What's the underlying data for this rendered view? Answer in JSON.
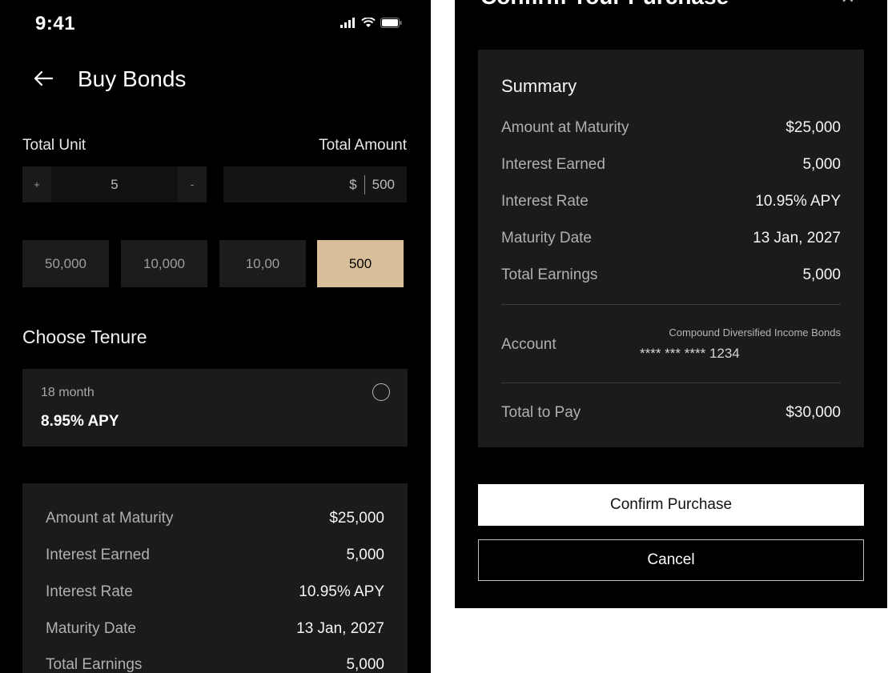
{
  "status_bar": {
    "time": "9:41",
    "icons": [
      "signal-icon",
      "wifi-icon",
      "battery-icon"
    ]
  },
  "header": {
    "title": "Buy Bonds",
    "back_icon": "arrow-left-icon"
  },
  "units": {
    "label": "Total Unit",
    "value": "5",
    "plus": "+",
    "minus": "-"
  },
  "amount": {
    "label": "Total Amount",
    "currency": "$",
    "value": "500"
  },
  "quick_amounts": [
    {
      "label": "50,000",
      "selected": false
    },
    {
      "label": "10,000",
      "selected": false
    },
    {
      "label": "10,00",
      "selected": false
    },
    {
      "label": "500",
      "selected": true
    }
  ],
  "tenure": {
    "title": "Choose Tenure",
    "option_label": "18 month",
    "option_apy": "8.95% APY"
  },
  "details": [
    {
      "key": "Amount at Maturity",
      "value": "$25,000"
    },
    {
      "key": "Interest Earned",
      "value": "5,000"
    },
    {
      "key": "Interest Rate",
      "value": "10.95% APY"
    },
    {
      "key": "Maturity Date",
      "value": "13 Jan, 2027"
    },
    {
      "key": "Total Earnings",
      "value": "5,000"
    }
  ],
  "confirm_panel": {
    "title": "Confirm Your Purchase",
    "summary_heading": "Summary",
    "rows": [
      {
        "key": "Amount at Maturity",
        "value": "$25,000"
      },
      {
        "key": "Interest Earned",
        "value": "5,000"
      },
      {
        "key": "Interest Rate",
        "value": "10.95% APY"
      },
      {
        "key": "Maturity Date",
        "value": "13 Jan, 2027"
      },
      {
        "key": "Total Earnings",
        "value": "5,000"
      }
    ],
    "account": {
      "label": "Account",
      "name": "Compound Diversified Income Bonds",
      "number": "**** *** **** 1234"
    },
    "total": {
      "key": "Total to Pay",
      "value": "$30,000"
    },
    "confirm_label": "Confirm Purchase",
    "cancel_label": "Cancel"
  },
  "colors": {
    "accent": "#d8bf9a",
    "card": "#1b1b1b",
    "background": "#000000"
  }
}
